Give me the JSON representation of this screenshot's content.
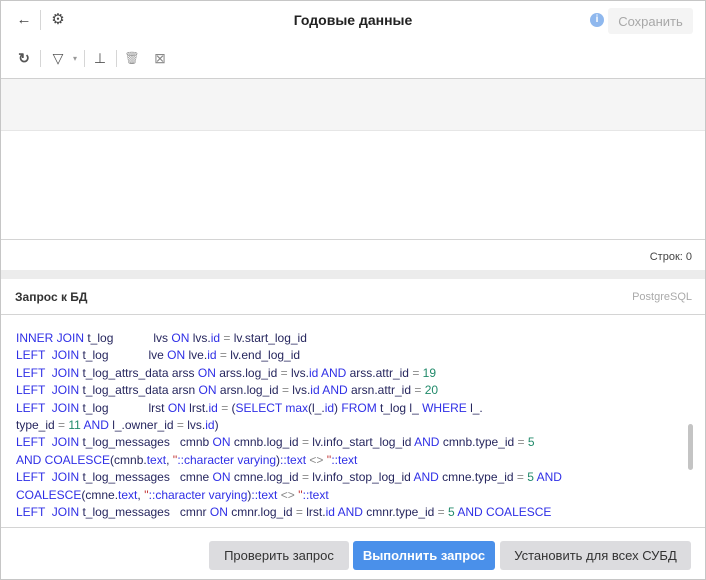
{
  "header": {
    "title": "Годовые данные",
    "save_label": "Сохранить",
    "info_icon": "i",
    "back_icon": "←",
    "settings_icon": "⚙"
  },
  "toolbar": {
    "refresh_icon": "↻",
    "filter_icon": "▽",
    "filter_caret": "▾",
    "insert_icon": "⊥",
    "delete_icon": "🗑",
    "clear_icon": "⊠"
  },
  "grid": {
    "rows_label": "Строк: 0"
  },
  "query_panel": {
    "title": "Запрос к БД",
    "dialect": "PostgreSQL"
  },
  "code_lines": [
    [
      [
        "k",
        "INNER JOIN "
      ],
      [
        "i",
        "t_log            lvs "
      ],
      [
        "k",
        "ON "
      ],
      [
        "i",
        "lvs."
      ],
      [
        "k",
        "id"
      ],
      [
        "o",
        " = "
      ],
      [
        "i",
        "lv.start_log_id"
      ]
    ],
    [
      [
        "k",
        "LEFT  JOIN "
      ],
      [
        "i",
        "t_log            lve "
      ],
      [
        "k",
        "ON "
      ],
      [
        "i",
        "lve."
      ],
      [
        "k",
        "id"
      ],
      [
        "o",
        " = "
      ],
      [
        "i",
        "lv.end_log_id"
      ]
    ],
    [
      [
        "k",
        "LEFT  JOIN "
      ],
      [
        "i",
        "t_log_attrs_data arss "
      ],
      [
        "k",
        "ON "
      ],
      [
        "i",
        "arss.log_id"
      ],
      [
        "o",
        " = "
      ],
      [
        "i",
        "lvs."
      ],
      [
        "k",
        "id AND "
      ],
      [
        "i",
        "arss.attr_id"
      ],
      [
        "o",
        " = "
      ],
      [
        "n",
        "19"
      ]
    ],
    [
      [
        "k",
        "LEFT  JOIN "
      ],
      [
        "i",
        "t_log_attrs_data arsn "
      ],
      [
        "k",
        "ON "
      ],
      [
        "i",
        "arsn.log_id"
      ],
      [
        "o",
        " = "
      ],
      [
        "i",
        "lvs."
      ],
      [
        "k",
        "id AND "
      ],
      [
        "i",
        "arsn.attr_id"
      ],
      [
        "o",
        " = "
      ],
      [
        "n",
        "20"
      ]
    ],
    [
      [
        "k",
        "LEFT  JOIN "
      ],
      [
        "i",
        "t_log            lrst "
      ],
      [
        "k",
        "ON "
      ],
      [
        "i",
        "lrst."
      ],
      [
        "k",
        "id"
      ],
      [
        "o",
        " = "
      ],
      [
        "i",
        "("
      ],
      [
        "k",
        "SELECT max"
      ],
      [
        "i",
        "(l_."
      ],
      [
        "k",
        "id"
      ],
      [
        "i",
        ") "
      ],
      [
        "k",
        "FROM "
      ],
      [
        "i",
        "t_log l_ "
      ],
      [
        "k",
        "WHERE "
      ],
      [
        "i",
        "l_."
      ]
    ],
    [
      [
        "i",
        "type_id"
      ],
      [
        "o",
        " = "
      ],
      [
        "n",
        "11 "
      ],
      [
        "k",
        "AND "
      ],
      [
        "i",
        "l_.owner_id"
      ],
      [
        "o",
        " = "
      ],
      [
        "i",
        "lvs."
      ],
      [
        "k",
        "id"
      ],
      [
        "i",
        ")"
      ]
    ],
    [
      [
        "k",
        "LEFT  JOIN "
      ],
      [
        "i",
        "t_log_messages   cmnb "
      ],
      [
        "k",
        "ON "
      ],
      [
        "i",
        "cmnb.log_id"
      ],
      [
        "o",
        " = "
      ],
      [
        "i",
        "lv.info_start_log_id "
      ],
      [
        "k",
        "AND "
      ],
      [
        "i",
        "cmnb.type_id"
      ],
      [
        "o",
        " = "
      ],
      [
        "n",
        "5"
      ]
    ],
    [
      [
        "k",
        "AND COALESCE"
      ],
      [
        "i",
        "(cmnb."
      ],
      [
        "k",
        "text"
      ],
      [
        "i",
        ", "
      ],
      [
        "s",
        "''"
      ],
      [
        "k",
        "::character varying"
      ],
      [
        "i",
        ")"
      ],
      [
        "k",
        "::text"
      ],
      [
        "o",
        " <> "
      ],
      [
        "s",
        "''"
      ],
      [
        "k",
        "::text"
      ]
    ],
    [
      [
        "k",
        "LEFT  JOIN "
      ],
      [
        "i",
        "t_log_messages   cmne "
      ],
      [
        "k",
        "ON "
      ],
      [
        "i",
        "cmne.log_id"
      ],
      [
        "o",
        " = "
      ],
      [
        "i",
        "lv.info_stop_log_id "
      ],
      [
        "k",
        "AND "
      ],
      [
        "i",
        "cmne.type_id"
      ],
      [
        "o",
        " = "
      ],
      [
        "n",
        "5 "
      ],
      [
        "k",
        "AND"
      ]
    ],
    [
      [
        "k",
        "COALESCE"
      ],
      [
        "i",
        "(cmne."
      ],
      [
        "k",
        "text"
      ],
      [
        "i",
        ", "
      ],
      [
        "s",
        "''"
      ],
      [
        "k",
        "::character varying"
      ],
      [
        "i",
        ")"
      ],
      [
        "k",
        "::text"
      ],
      [
        "o",
        " <> "
      ],
      [
        "s",
        "''"
      ],
      [
        "k",
        "::text"
      ]
    ],
    [
      [
        "k",
        "LEFT  JOIN "
      ],
      [
        "i",
        "t_log_messages   cmnr "
      ],
      [
        "k",
        "ON "
      ],
      [
        "i",
        "cmnr.log_id"
      ],
      [
        "o",
        " = "
      ],
      [
        "i",
        "lrst."
      ],
      [
        "k",
        "id AND "
      ],
      [
        "i",
        "cmnr.type_id"
      ],
      [
        "o",
        " = "
      ],
      [
        "n",
        "5 "
      ],
      [
        "k",
        "AND COALESCE"
      ]
    ]
  ],
  "footer": {
    "check_label": "Проверить запрос",
    "run_label": "Выполнить запрос",
    "apply_all_label": "Установить для всех СУБД"
  }
}
